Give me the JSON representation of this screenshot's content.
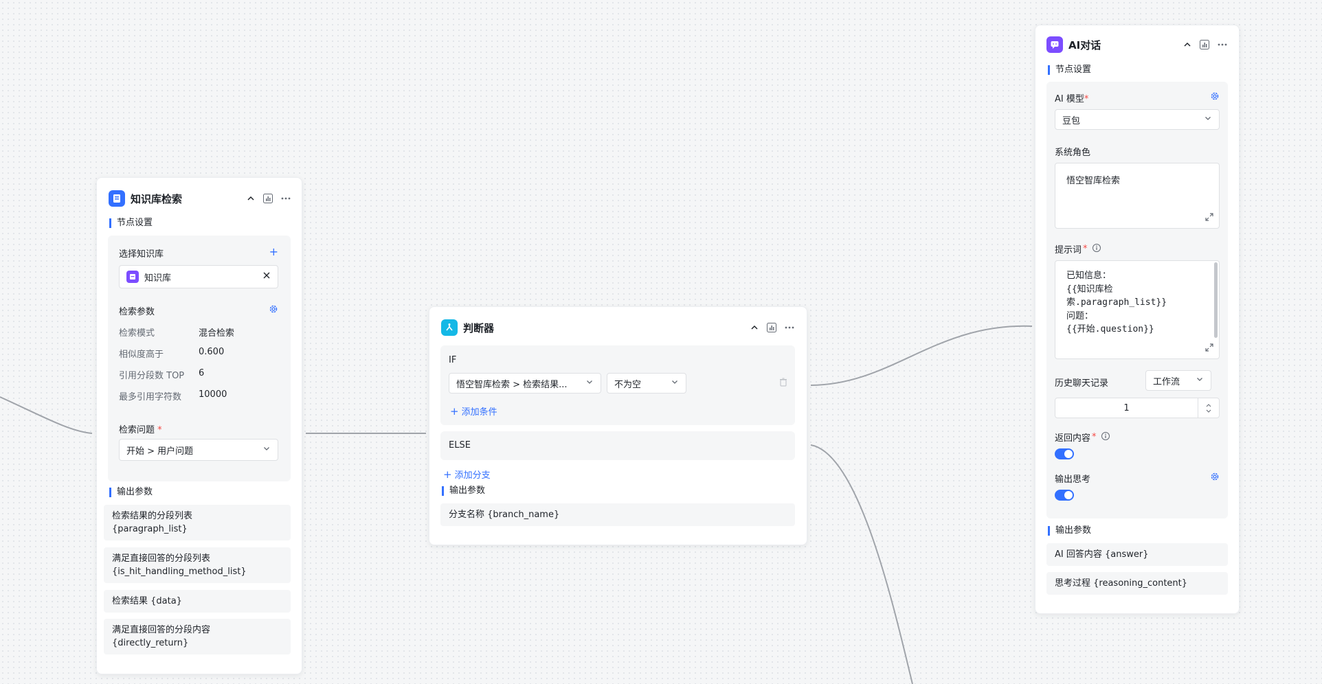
{
  "header_actions": {
    "collapse": "collapse-icon",
    "stats": "stats-icon",
    "more": "more-icon"
  },
  "accent_color": "#3370ff",
  "kb_node": {
    "title": "知识库检索",
    "settings_section": "节点设置",
    "select_kb_label": "选择知识库",
    "kb_item": "知识库",
    "params_label": "检索参数",
    "params": [
      {
        "label": "检索模式",
        "value": "混合检索"
      },
      {
        "label": "相似度高于",
        "value": "0.600"
      },
      {
        "label": "引用分段数 TOP",
        "value": "6"
      },
      {
        "label": "最多引用字符数",
        "value": "10000"
      }
    ],
    "question_label": "检索问题",
    "required_mark": "*",
    "question_value": "开始 > 用户问题",
    "output_section": "输出参数",
    "outputs": [
      {
        "line1": "检索结果的分段列表",
        "line2": "{paragraph_list}"
      },
      {
        "line1": "满足直接回答的分段列表",
        "line2": "{is_hit_handling_method_list}"
      },
      {
        "line1": "检索结果 {data}",
        "line2": ""
      },
      {
        "line1": "满足直接回答的分段内容",
        "line2": "{directly_return}"
      }
    ]
  },
  "judge_node": {
    "title": "判断器",
    "if_label": "IF",
    "condition_field": "悟空智库检索 > 检索结果...",
    "condition_op": "不为空",
    "add_condition": "添加条件",
    "else_label": "ELSE",
    "add_branch": "添加分支",
    "output_section": "输出参数",
    "output_item": "分支名称 {branch_name}"
  },
  "ai_node": {
    "title": "AI对话",
    "settings_section": "节点设置",
    "model_label": "AI 模型",
    "required_mark": "*",
    "model_value": "豆包",
    "role_label": "系统角色",
    "role_value": "悟空智库检索",
    "prompt_label": "提示词",
    "prompt_lines": [
      "已知信息：",
      "{{知识库检",
      "索.paragraph_list}}",
      "问题：",
      "{{开始.question}}"
    ],
    "history_label": "历史聊天记录",
    "history_source": "工作流",
    "history_count": "1",
    "return_label": "返回内容",
    "return_on": true,
    "thinking_label": "输出思考",
    "thinking_on": true,
    "output_section": "输出参数",
    "outputs": [
      "AI 回答内容 {answer}",
      "思考过程 {reasoning_content}"
    ]
  }
}
